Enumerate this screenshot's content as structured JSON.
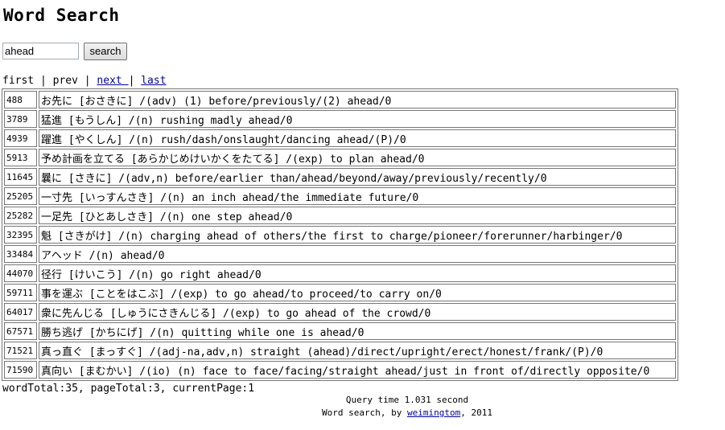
{
  "page": {
    "title": "Word Search"
  },
  "search": {
    "value": "ahead",
    "button_label": "search"
  },
  "pager": {
    "first": "first",
    "sep1": " | ",
    "prev": "prev",
    "sep2": " | ",
    "next": "next ",
    "sep3": "| ",
    "last": "last"
  },
  "results": [
    {
      "id": "488",
      "entry": "お先に [おさきに] /(adv) (1) before/previously/(2) ahead/0"
    },
    {
      "id": "3789",
      "entry": "猛進 [もうしん] /(n) rushing madly ahead/0"
    },
    {
      "id": "4939",
      "entry": "躍進 [やくしん] /(n) rush/dash/onslaught/dancing ahead/(P)/0"
    },
    {
      "id": "5913",
      "entry": "予め計画を立てる [あらかじめけいかくをたてる] /(exp) to plan ahead/0"
    },
    {
      "id": "11645",
      "entry": "曩に [さきに] /(adv,n) before/earlier than/ahead/beyond/away/previously/recently/0"
    },
    {
      "id": "25205",
      "entry": "一寸先 [いっすんさき] /(n) an inch ahead/the immediate future/0"
    },
    {
      "id": "25282",
      "entry": "一足先 [ひとあしさき] /(n) one step ahead/0"
    },
    {
      "id": "32395",
      "entry": "魁 [さきがけ] /(n) charging ahead of others/the first to charge/pioneer/forerunner/harbinger/0"
    },
    {
      "id": "33484",
      "entry": "アヘッド /(n) ahead/0"
    },
    {
      "id": "44070",
      "entry": "径行 [けいこう] /(n) go right ahead/0"
    },
    {
      "id": "59711",
      "entry": "事を運ぶ [ことをはこぶ] /(exp) to go ahead/to proceed/to carry on/0"
    },
    {
      "id": "64017",
      "entry": "衆に先んじる [しゅうにさきんじる] /(exp) to go ahead of the crowd/0"
    },
    {
      "id": "67571",
      "entry": "勝ち逃げ [かちにげ] /(n) quitting while one is ahead/0"
    },
    {
      "id": "71521",
      "entry": "真っ直ぐ [まっすぐ] /(adj-na,adv,n) straight (ahead)/direct/upright/erect/honest/frank/(P)/0"
    },
    {
      "id": "71590",
      "entry": "真向い [まむかい] /(io) (n) face to face/facing/straight ahead/just in front of/directly opposite/0"
    }
  ],
  "summary": "wordTotal:35, pageTotal:3, currentPage:1",
  "footer": {
    "query_time": "Query time 1.031 second",
    "credit_prefix": "Word search, by ",
    "author_link": "weimingtom",
    "credit_suffix": ", 2011"
  },
  "colors": {
    "link": "#00009c",
    "border": "#777777"
  }
}
